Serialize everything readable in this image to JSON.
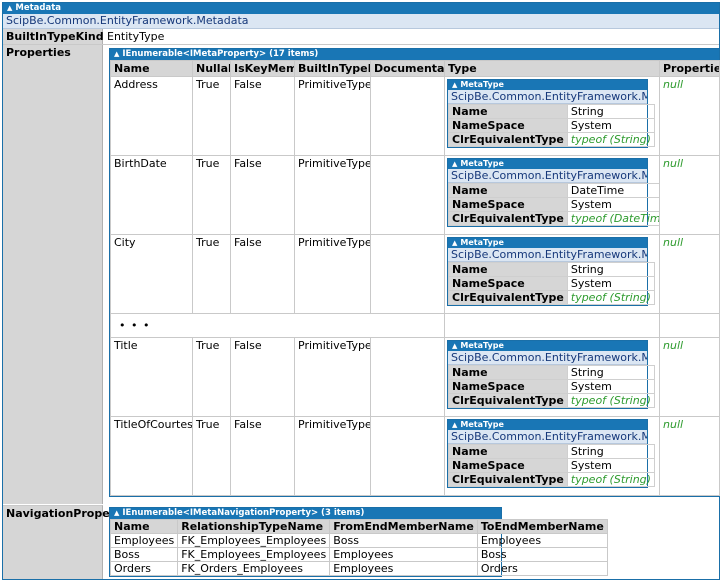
{
  "root": {
    "header": "Metadata",
    "type_name": "ScipBe.Common.EntityFramework.Metadata",
    "fields": {
      "builtin_label": "BuiltInTypeKind",
      "builtin_value": "EntityType",
      "properties_label": "Properties",
      "navigation_label": "NavigationProperties"
    }
  },
  "properties": {
    "header": "IEnumerable<IMetaProperty> (17 items)",
    "columns": [
      "Name",
      "Nullable",
      "IsKeyMember",
      "BuiltInTypeKind",
      "Documentation",
      "Type",
      "Properties"
    ],
    "rows": [
      {
        "name": "Address",
        "nullable": "True",
        "iskey": "False",
        "kind": "PrimitiveType",
        "meta_header": "MetaType",
        "meta_type": "ScipBe.Common.EntityFramework.MetaType",
        "k_name": "Name",
        "v_name": "String",
        "k_ns": "NameSpace",
        "v_ns": "System",
        "k_clr": "ClrEquivalentType",
        "v_clr": "typeof (String)",
        "props": "null"
      },
      {
        "name": "BirthDate",
        "nullable": "True",
        "iskey": "False",
        "kind": "PrimitiveType",
        "meta_header": "MetaType",
        "meta_type": "ScipBe.Common.EntityFramework.MetaType",
        "k_name": "Name",
        "v_name": "DateTime",
        "k_ns": "NameSpace",
        "v_ns": "System",
        "k_clr": "ClrEquivalentType",
        "v_clr": "typeof (DateTime)",
        "props": "null"
      },
      {
        "name": "City",
        "nullable": "True",
        "iskey": "False",
        "kind": "PrimitiveType",
        "meta_header": "MetaType",
        "meta_type": "ScipBe.Common.EntityFramework.MetaType",
        "k_name": "Name",
        "v_name": "String",
        "k_ns": "NameSpace",
        "v_ns": "System",
        "k_clr": "ClrEquivalentType",
        "v_clr": "typeof (String)",
        "props": "null"
      },
      {
        "name": "Title",
        "nullable": "True",
        "iskey": "False",
        "kind": "PrimitiveType",
        "meta_header": "MetaType",
        "meta_type": "ScipBe.Common.EntityFramework.MetaType",
        "k_name": "Name",
        "v_name": "String",
        "k_ns": "NameSpace",
        "v_ns": "System",
        "k_clr": "ClrEquivalentType",
        "v_clr": "typeof (String)",
        "props": "null"
      },
      {
        "name": "TitleOfCourtesy",
        "nullable": "True",
        "iskey": "False",
        "kind": "PrimitiveType",
        "meta_header": "MetaType",
        "meta_type": "ScipBe.Common.EntityFramework.MetaType",
        "k_name": "Name",
        "v_name": "String",
        "k_ns": "NameSpace",
        "v_ns": "System",
        "k_clr": "ClrEquivalentType",
        "v_clr": "typeof (String)",
        "props": "null"
      }
    ],
    "ellipsis": "• • •"
  },
  "navigation": {
    "header": "IEnumerable<IMetaNavigationProperty> (3 items)",
    "columns": [
      "Name",
      "RelationshipTypeName",
      "FromEndMemberName",
      "ToEndMemberName"
    ],
    "rows": [
      [
        "Employees",
        "FK_Employees_Employees",
        "Boss",
        "Employees"
      ],
      [
        "Boss",
        "FK_Employees_Employees",
        "Employees",
        "Boss"
      ],
      [
        "Orders",
        "FK_Orders_Employees",
        "Employees",
        "Orders"
      ]
    ]
  },
  "colors": {
    "header_blue": "#1976b5",
    "green_text": "#2e9b2e"
  },
  "icons": {
    "collapse": "triangle-up-icon"
  }
}
